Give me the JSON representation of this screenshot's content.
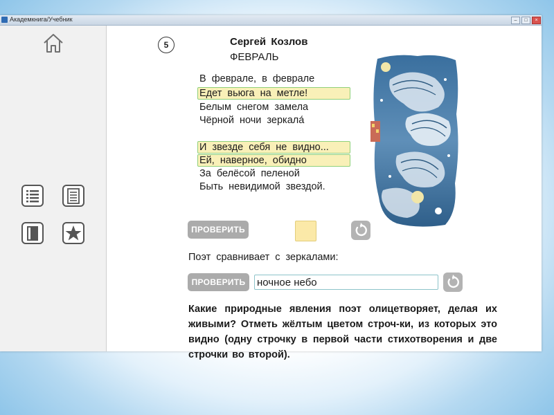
{
  "window": {
    "title": "Академкнига/Учебник"
  },
  "sidebar": {
    "icons": [
      "home-icon",
      "list-icon",
      "document-icon",
      "notebook-icon",
      "star-icon"
    ]
  },
  "exercise": {
    "number": "5",
    "author": "Сергей Козлов",
    "title": "ФЕВРАЛЬ",
    "poem_lines": [
      {
        "text": "В феврале, в феврале",
        "highlighted": false
      },
      {
        "text": "Едет вьюга на метле!",
        "highlighted": true
      },
      {
        "text": "Белым снегом замела",
        "highlighted": false
      },
      {
        "text": "Чёрной ночи зеркала́",
        "highlighted": false
      },
      {
        "text": "И звезде себя не видно...",
        "highlighted": true
      },
      {
        "text": "Ей, наверное, обидно",
        "highlighted": true
      },
      {
        "text": "За белёсой пеленой",
        "highlighted": false
      },
      {
        "text": "Быть невидимой звездой.",
        "highlighted": false
      }
    ],
    "check_label_1": "ПРОВЕРИТЬ",
    "compare_text": "Поэт сравнивает с зеркалами:",
    "check_label_2": "ПРОВЕРИТЬ",
    "answer_value": "ночное небо",
    "question": "Какие природные явления поэт олицетворяет, делая их живыми? Отметь жёлтым цветом строч-ки, из которых это видно (одну строчку в первой части стихотворения и две строчки во второй)."
  },
  "colors": {
    "highlight_fill": "#f9f0b8",
    "highlight_border": "#8fd07a",
    "check_button": "#ababab",
    "input_border": "#8cc3c9"
  }
}
